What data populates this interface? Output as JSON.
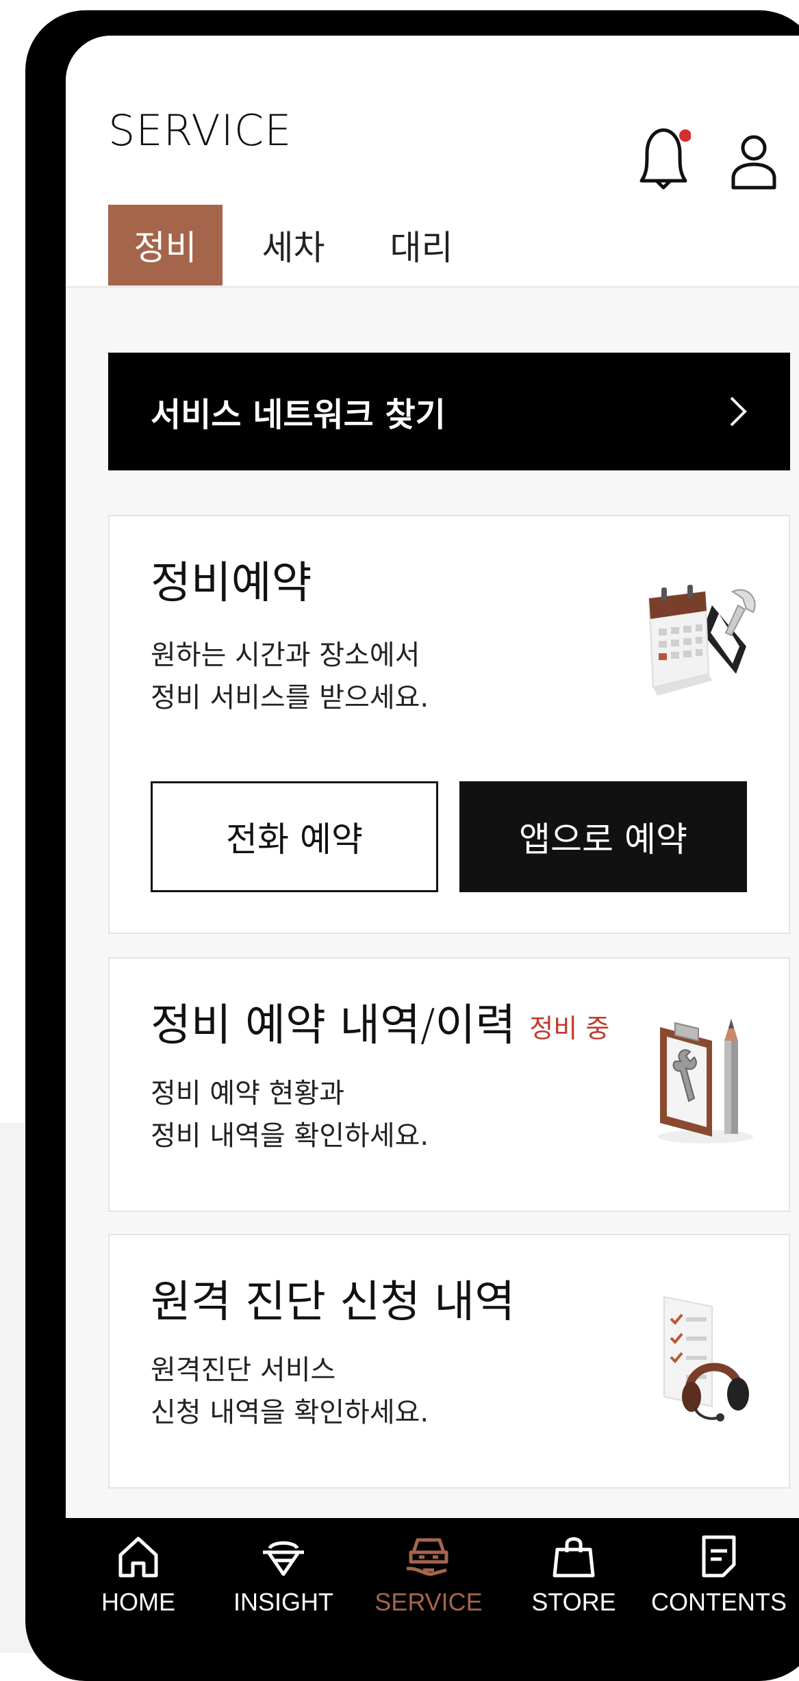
{
  "app_title": "SERVICE",
  "tabs": [
    {
      "label": "정비",
      "active": true
    },
    {
      "label": "세차",
      "active": false
    },
    {
      "label": "대리",
      "active": false
    }
  ],
  "network_button": {
    "label": "서비스 네트워크 찾기",
    "icon": "chevron-right-icon"
  },
  "cards": [
    {
      "title": "정비예약",
      "desc_line1": "원하는 시간과 장소에서",
      "desc_line2": "정비 서비스를 받으세요.",
      "phone_button": "전화 예약",
      "app_button": "앱으로 예약",
      "icon": "calendar-wrench-icon"
    },
    {
      "title": "정비 예약 내역/이력",
      "badge": "정비 중",
      "desc_line1": "정비 예약 현황과",
      "desc_line2": "정비 내역을 확인하세요.",
      "icon": "clipboard-wrench-icon"
    },
    {
      "title": "원격 진단 신청 내역",
      "desc_line1": "원격진단 서비스",
      "desc_line2": "신청 내역을 확인하세요.",
      "icon": "checklist-headset-icon"
    }
  ],
  "bottom_nav": [
    {
      "label": "HOME",
      "icon": "home-icon"
    },
    {
      "label": "INSIGHT",
      "icon": "insight-icon"
    },
    {
      "label": "SERVICE",
      "icon": "service-car-icon",
      "active": true
    },
    {
      "label": "STORE",
      "icon": "shopping-bag-icon"
    },
    {
      "label": "CONTENTS",
      "icon": "document-icon"
    }
  ],
  "colors": {
    "accent": "#a5654b",
    "badge": "#c0392b",
    "notification_dot": "#d32f2f"
  }
}
